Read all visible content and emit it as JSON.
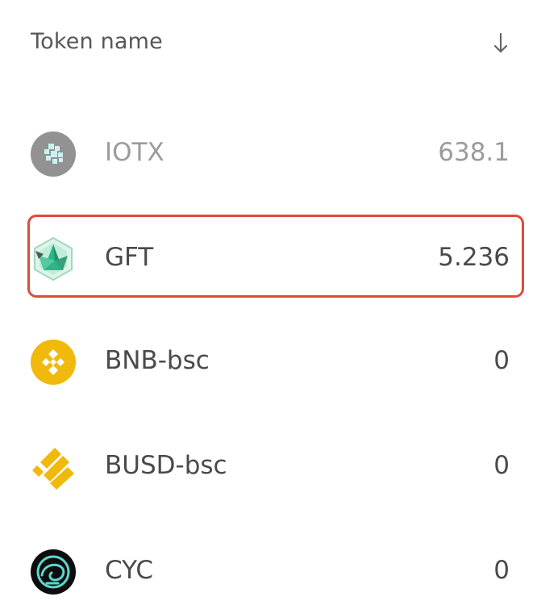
{
  "header": {
    "title": "Token name",
    "sort_icon": "arrow-down-icon"
  },
  "tokens": [
    {
      "name": "IOTX",
      "amount": "638.1",
      "icon": "iotx-logo-icon",
      "muted": true
    },
    {
      "name": "GFT",
      "amount": "5.236",
      "icon": "gft-logo-icon",
      "highlighted": true
    },
    {
      "name": "BNB-bsc",
      "amount": "0",
      "icon": "bnb-logo-icon"
    },
    {
      "name": "BUSD-bsc",
      "amount": "0",
      "icon": "busd-logo-icon"
    },
    {
      "name": "CYC",
      "amount": "0",
      "icon": "cyc-logo-icon"
    }
  ],
  "colors": {
    "highlight_border": "#e04a3a",
    "text": "#4a4a4a",
    "bnb_yellow": "#f0b90b"
  }
}
